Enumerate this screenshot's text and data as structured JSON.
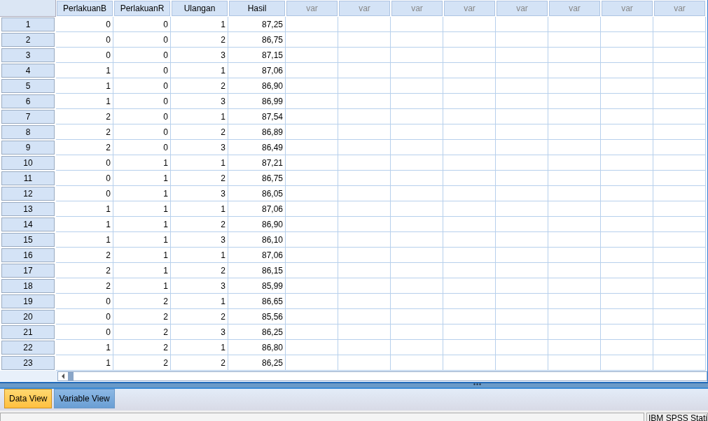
{
  "table": {
    "columns": [
      "PerlakuanB",
      "PerlakuanR",
      "Ulangan",
      "Hasil",
      "var",
      "var",
      "var",
      "var",
      "var",
      "var",
      "var",
      "var"
    ],
    "rows": [
      {
        "number": "1",
        "cells": [
          "0",
          "0",
          "1",
          "87,25"
        ]
      },
      {
        "number": "2",
        "cells": [
          "0",
          "0",
          "2",
          "86,75"
        ]
      },
      {
        "number": "3",
        "cells": [
          "0",
          "0",
          "3",
          "87,15"
        ]
      },
      {
        "number": "4",
        "cells": [
          "1",
          "0",
          "1",
          "87,06"
        ]
      },
      {
        "number": "5",
        "cells": [
          "1",
          "0",
          "2",
          "86,90"
        ]
      },
      {
        "number": "6",
        "cells": [
          "1",
          "0",
          "3",
          "86,99"
        ]
      },
      {
        "number": "7",
        "cells": [
          "2",
          "0",
          "1",
          "87,54"
        ]
      },
      {
        "number": "8",
        "cells": [
          "2",
          "0",
          "2",
          "86,89"
        ]
      },
      {
        "number": "9",
        "cells": [
          "2",
          "0",
          "3",
          "86,49"
        ]
      },
      {
        "number": "10",
        "cells": [
          "0",
          "1",
          "1",
          "87,21"
        ]
      },
      {
        "number": "11",
        "cells": [
          "0",
          "1",
          "2",
          "86,75"
        ]
      },
      {
        "number": "12",
        "cells": [
          "0",
          "1",
          "3",
          "86,05"
        ]
      },
      {
        "number": "13",
        "cells": [
          "1",
          "1",
          "1",
          "87,06"
        ]
      },
      {
        "number": "14",
        "cells": [
          "1",
          "1",
          "2",
          "86,90"
        ]
      },
      {
        "number": "15",
        "cells": [
          "1",
          "1",
          "3",
          "86,10"
        ]
      },
      {
        "number": "16",
        "cells": [
          "2",
          "1",
          "1",
          "87,06"
        ]
      },
      {
        "number": "17",
        "cells": [
          "2",
          "1",
          "2",
          "86,15"
        ]
      },
      {
        "number": "18",
        "cells": [
          "2",
          "1",
          "3",
          "85,99"
        ]
      },
      {
        "number": "19",
        "cells": [
          "0",
          "2",
          "1",
          "86,65"
        ]
      },
      {
        "number": "20",
        "cells": [
          "0",
          "2",
          "2",
          "85,56"
        ]
      },
      {
        "number": "21",
        "cells": [
          "0",
          "2",
          "3",
          "86,25"
        ]
      },
      {
        "number": "22",
        "cells": [
          "1",
          "2",
          "1",
          "86,80"
        ]
      },
      {
        "number": "23",
        "cells": [
          "1",
          "2",
          "2",
          "86,25"
        ]
      }
    ]
  },
  "tabs": [
    {
      "label": "Data View",
      "selected": true
    },
    {
      "label": "Variable View",
      "selected": false
    }
  ],
  "status_bar": {
    "text": "IBM SPSS Stati"
  }
}
